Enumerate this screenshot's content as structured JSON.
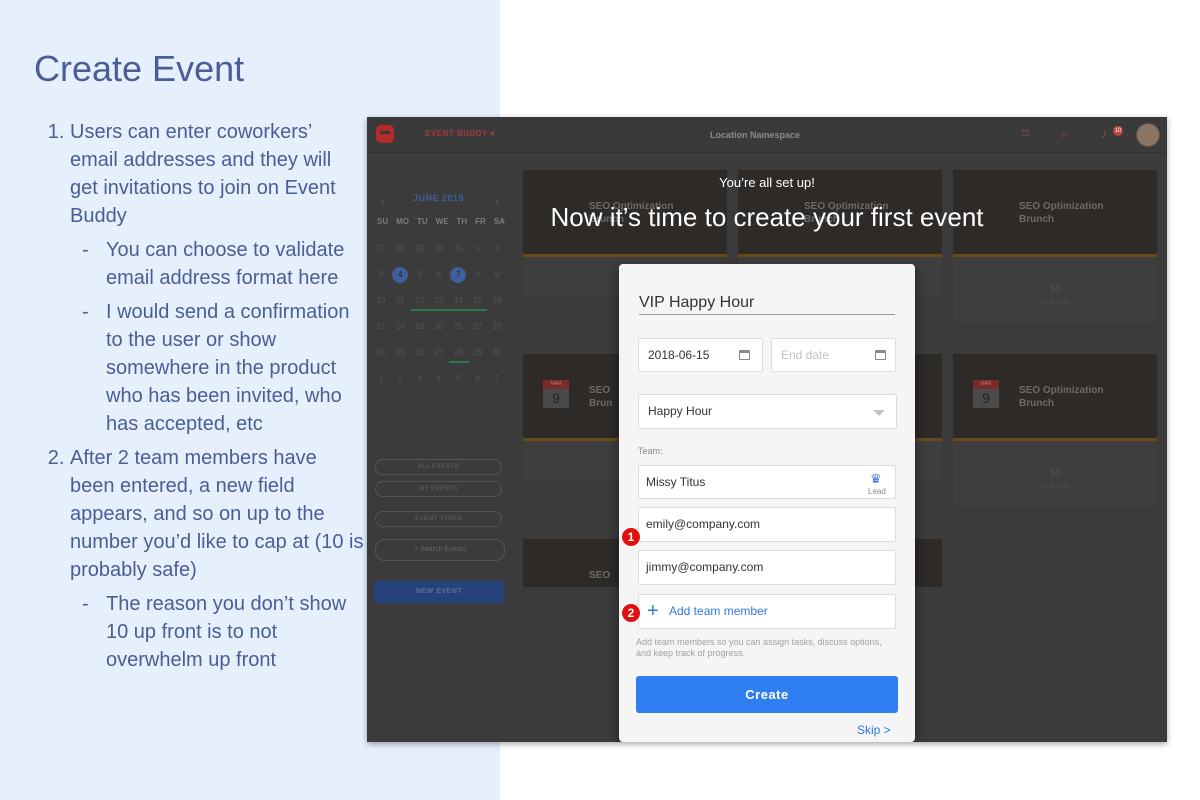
{
  "slide": {
    "title": "Create Event",
    "notes": [
      {
        "text": "Users can enter coworkers’ email addresses and they will get invitations to join on Event Buddy",
        "subs": [
          "You can choose to validate email address format here",
          "I would send a confirmation to the user or show somewhere in the product who has been invited, who has accepted, etc"
        ]
      },
      {
        "text": "After 2 team members have been entered, a new field appears, and so on up to the number you’d like to cap at (10 is probably safe)",
        "subs": [
          "The reason you don’t show 10 up front is to not overwhelm up front"
        ]
      }
    ]
  },
  "app": {
    "brand": "EVENT BUDDY",
    "header_title": "Location Namespace",
    "notification_count": "10",
    "calendar": {
      "month": "JUNE 2018",
      "prev": "‹",
      "next": "›",
      "days_of_week": [
        "SU",
        "MO",
        "TU",
        "WE",
        "TH",
        "FR",
        "SA"
      ],
      "weeks": [
        [
          "27",
          "28",
          "29",
          "30",
          "31",
          "1",
          "2"
        ],
        [
          "3",
          "4",
          "5",
          "6",
          "7",
          "8",
          "9"
        ],
        [
          "10",
          "11",
          "12",
          "13",
          "14",
          "15",
          "16"
        ],
        [
          "17",
          "18",
          "19",
          "20",
          "21",
          "22",
          "23"
        ],
        [
          "24",
          "25",
          "26",
          "27",
          "28",
          "29",
          "30"
        ],
        [
          "1",
          "2",
          "3",
          "4",
          "5",
          "6",
          "7"
        ]
      ]
    },
    "sidebar": {
      "all_events": "ALL EVENTS",
      "my_events": "MY EVENTS",
      "event_types": "EVENT TYPES",
      "search_placeholder": "Search Events",
      "new_event": "NEW EVENT"
    },
    "cards": {
      "title_line1": "SEO Optimization",
      "title_line2": "Brunch",
      "month": "MAR",
      "day": "9",
      "guest_count": "10",
      "guest_label": "GUESTS",
      "partial_title_1": "SEO",
      "partial_title_2": "Brun"
    }
  },
  "overlay": {
    "subtitle": "You’re all set up!",
    "title": "Now it’s time to create your first event"
  },
  "form": {
    "event_name": "VIP Happy Hour",
    "start_date": "2018-06-15",
    "end_date_placeholder": "End date",
    "event_type": "Happy Hour",
    "team_label": "Team:",
    "lead_name": "Missy Titus",
    "lead_label": "Lead",
    "members": [
      "emily@company.com",
      "jimmy@company.com"
    ],
    "add_member": "Add team member",
    "helper": "Add team members so you can assign tasks, discuss options, and keep track of progress.",
    "create": "Create",
    "skip": "Skip >"
  },
  "annotations": {
    "badge1": "1",
    "badge2": "2"
  }
}
